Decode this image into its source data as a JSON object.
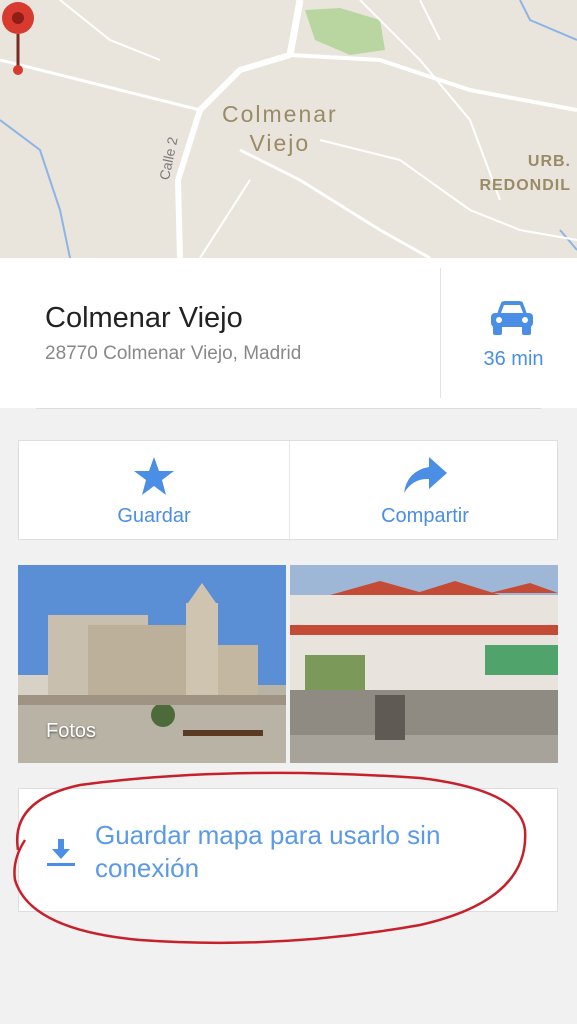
{
  "map": {
    "town_label_line1": "Colmenar",
    "town_label_line2": "Viejo",
    "urb_label_line1": "URB.",
    "urb_label_line2": "REDONDIL",
    "road_label": "Calle 2",
    "pin_color": "#d93a2f"
  },
  "place": {
    "name": "Colmenar Viejo",
    "address": "28770 Colmenar Viejo, Madrid"
  },
  "directions": {
    "icon": "car-icon",
    "time": "36 min"
  },
  "actions": {
    "save_label": "Guardar",
    "share_label": "Compartir"
  },
  "photos": {
    "label": "Fotos"
  },
  "offline": {
    "icon": "download-icon",
    "label": "Guardar mapa para usarlo sin conexión"
  },
  "colors": {
    "accent": "#4a8ee6",
    "annotation": "#c8202a"
  }
}
